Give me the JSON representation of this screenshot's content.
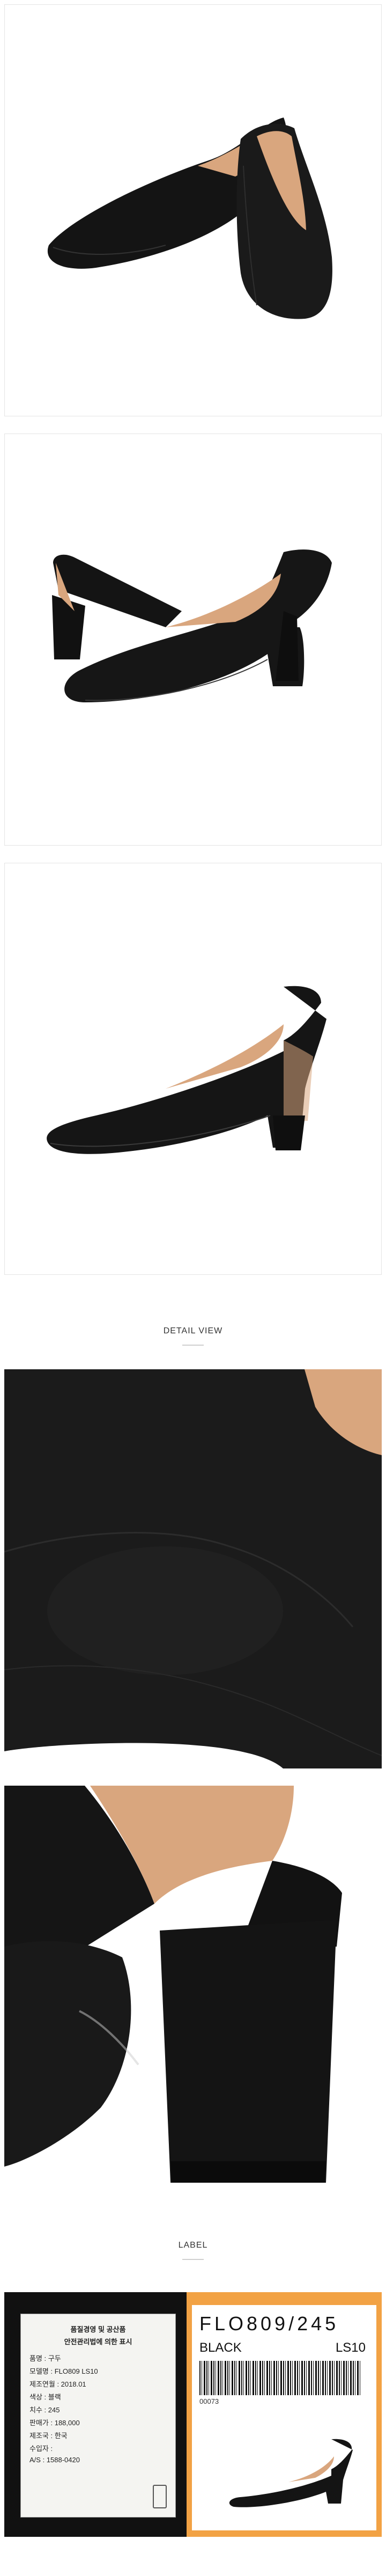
{
  "sections": {
    "detail_heading": "DETAIL VIEW",
    "label_heading": "LABEL"
  },
  "label_tag": {
    "code": "FLO809/245",
    "color": "BLACK",
    "size_code": "LS10",
    "barcode_number": "00073"
  },
  "care_label": {
    "lines": [
      "품질경영 및 공산품",
      "안전관리법에 의한 표시",
      "품명 : 구두",
      "모델명 : FLO809 LS10",
      "제조연월 : 2018.01",
      "색상 : 블랙",
      "치수 : 245",
      "판매가 : 188,000",
      "제조국 : 한국",
      "수입자 :",
      "A/S : 1588-0420"
    ]
  },
  "colors": {
    "background": "#ffffff",
    "panel_border": "#e4e4e4",
    "shoe_black": "#141414",
    "shoe_lining": "#d9a67e",
    "label_orange": "#f2a244",
    "label_paper": "#f4f4f1"
  }
}
